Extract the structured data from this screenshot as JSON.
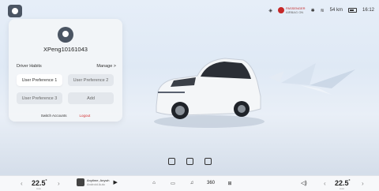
{
  "status": {
    "pass_title": "PASSENGER",
    "pass_sub": "AIRBAG ON",
    "range": "54 km",
    "time": "16:12"
  },
  "profile": {
    "username": "XPeng10161043",
    "section_title": "Driver Habits",
    "manage_label": "Manage >",
    "prefs": [
      "User Preference 1",
      "User Preference 2",
      "User Preference 3"
    ],
    "add_label": "Add",
    "switch_label": "Switch Accounts",
    "logout_label": "Logout"
  },
  "dock": {
    "left_temp": "22.5",
    "right_temp": "22.5",
    "temp_unit": "°",
    "temp_label": "Auto",
    "media_title": "Anytime, Anywh",
    "media_sub": "Android Auto",
    "dock_icons": [
      "home-icon",
      "car-icon",
      "music-icon",
      "360-view-icon",
      "apps-grid-icon"
    ],
    "view_label": "360",
    "volume_icon": "volume-icon"
  },
  "colors": {
    "logout": "#d32f2f",
    "badge": "#c62828",
    "accent": "#4b5563"
  }
}
